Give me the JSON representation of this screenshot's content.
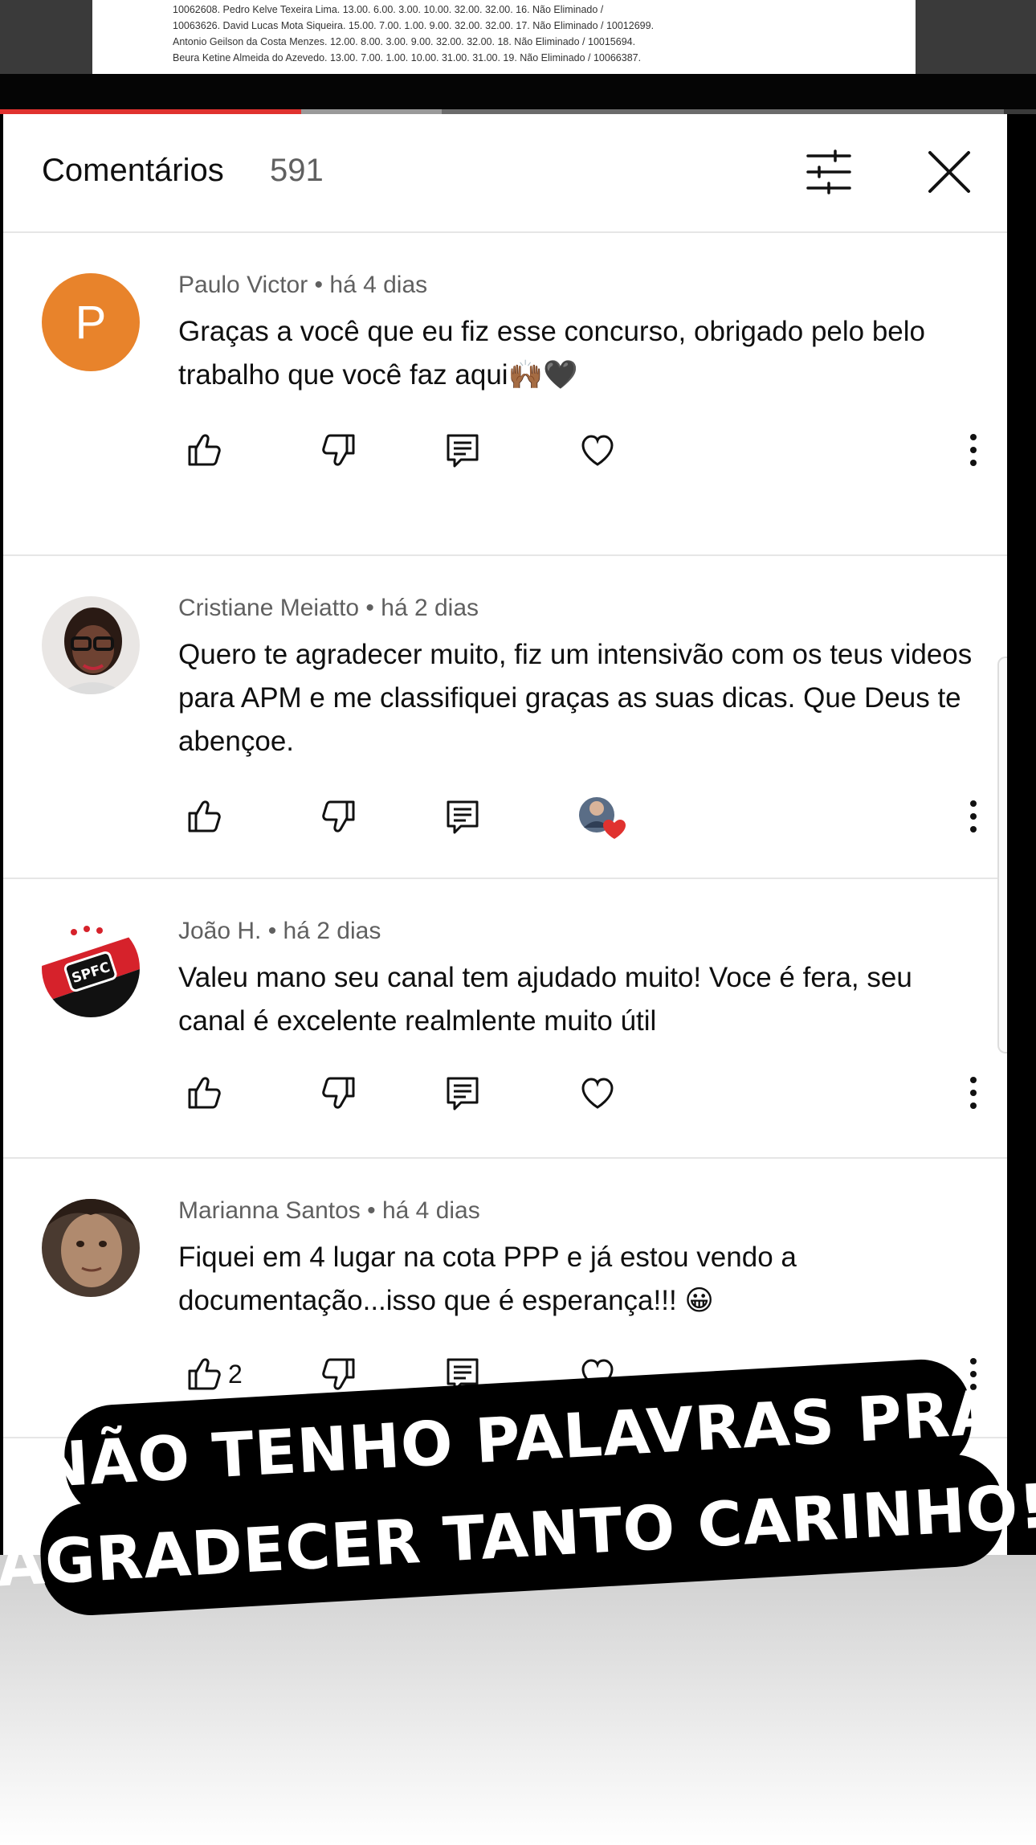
{
  "video": {
    "doc_lines": [
      "10062608. Pedro Kelve Texeira Lima. 13.00. 6.00. 3.00. 10.00. 32.00. 32.00. 16. Não Eliminado /",
      "10063626. David Lucas Mota Siqueira. 15.00. 7.00. 1.00. 9.00. 32.00. 32.00. 17. Não Eliminado / 10012699.",
      "Antonio Geilson da Costa Menzes. 12.00. 8.00. 3.00. 9.00. 32.00. 32.00. 18. Não Eliminado / 10015694.",
      "Beura Ketine Almeida do Azevedo. 13.00. 7.00. 1.00. 10.00. 31.00. 31.00. 19. Não Eliminado / 10066387."
    ],
    "progress_fraction": 0.3,
    "buffer_fraction": 0.44
  },
  "header": {
    "title": "Comentários",
    "count": "591"
  },
  "comments": [
    {
      "author": "Paulo Victor",
      "time": "há 4 dias",
      "meta": "Paulo Victor • há 4 dias",
      "avatar_letter": "P",
      "text": "Graças a você que eu fiz esse concurso, obrigado pelo belo trabalho que você faz aqui🙌🏾🖤",
      "likes": "",
      "creator_heart": false
    },
    {
      "author": "Cristiane Meiatto",
      "time": "há 2 dias",
      "meta": "Cristiane Meiatto • há 2 dias",
      "avatar_letter": "",
      "text": "Quero te agradecer muito, fiz um intensivão com os teus videos para APM e me classifiquei graças as suas dicas. Que Deus te abençoe.",
      "likes": "",
      "creator_heart": true
    },
    {
      "author": "João H.",
      "time": "há 2 dias",
      "meta": "João H. • há 2 dias",
      "avatar_letter": "",
      "avatar_badge": "SPFC",
      "text": "Valeu mano seu canal tem ajudado muito! Voce é fera, seu canal é excelente realmlente muito útil",
      "likes": "",
      "creator_heart": false
    },
    {
      "author": "Marianna Santos",
      "time": "há 4 dias",
      "meta": "Marianna Santos • há 4 dias",
      "avatar_letter": "",
      "text": "Fiquei em 4 lugar na cota PPP e já estou vendo a documentação...isso que é esperança!!! 😀",
      "likes": "2",
      "creator_heart": false
    }
  ],
  "icons": {
    "like": "thumbs-up-icon",
    "dislike": "thumbs-down-icon",
    "reply": "reply-icon",
    "heart": "heart-icon",
    "more": "more-vert-icon",
    "filter": "filter-icon",
    "close": "close-icon"
  },
  "colors": {
    "avatar_p": "#e8832b",
    "progress": "#e0322f",
    "heart": "#e0322f"
  },
  "sticker": {
    "line1": "NÃO TENHO PALAVRAS PRA",
    "line2": "AGRADECER TANTO CARINHO!"
  }
}
